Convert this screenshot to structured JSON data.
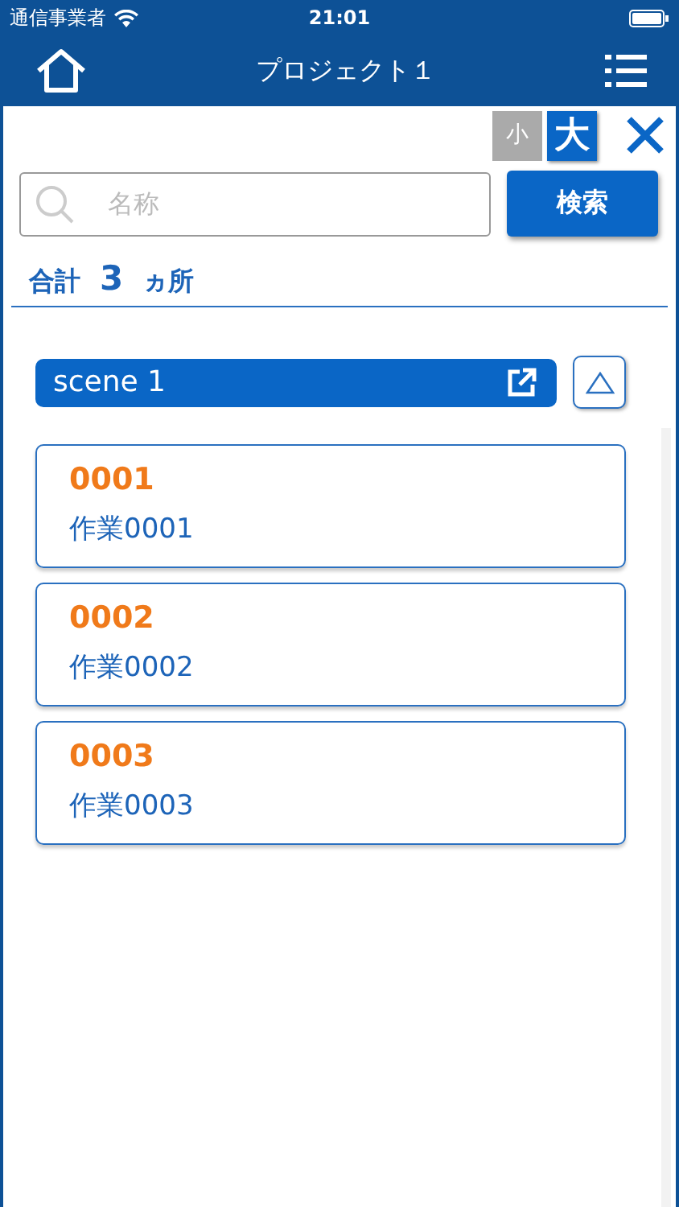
{
  "status_bar": {
    "carrier": "通信事業者",
    "time": "21:01"
  },
  "nav_bar": {
    "title": "プロジェクト１"
  },
  "size_toggle": [
    {
      "label": "小",
      "selected": false
    },
    {
      "label": "大",
      "selected": true
    }
  ],
  "search": {
    "placeholder": "名称",
    "button": "検索"
  },
  "total": {
    "label": "合計",
    "count": "3",
    "unit": "ヵ所"
  },
  "scene": {
    "title": "scene 1",
    "expanded": true
  },
  "items": [
    {
      "code": "0001",
      "name": "作業0001"
    },
    {
      "code": "0002",
      "name": "作業0002"
    },
    {
      "code": "0003",
      "name": "作業0003"
    }
  ]
}
